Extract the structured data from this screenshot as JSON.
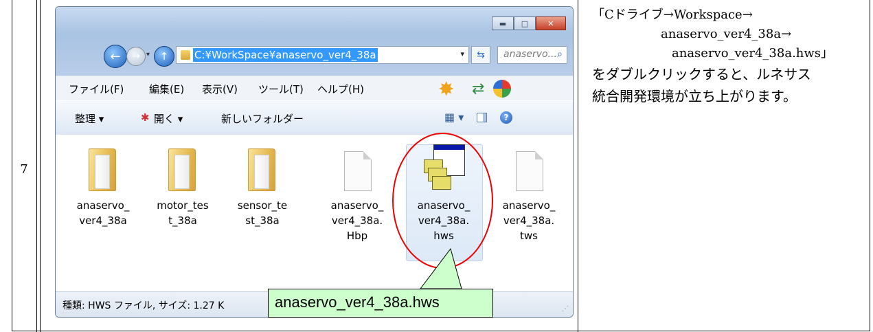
{
  "row": {
    "number": "7"
  },
  "description": {
    "line1": "「Cドライブ→Workspace→",
    "line2": "anaservo_ver4_38a→",
    "line3": "anaservo_ver4_38a.hws」",
    "line4": "をダブルクリックすると、ルネサス",
    "line5": "統合開発環境が立ち上がります。"
  },
  "window": {
    "address_path": "C:¥WorkSpace¥anaservo_ver4_38a",
    "search_placeholder": "anaservo...",
    "menu": [
      "ファイル(F)",
      "編集(E)",
      "表示(V)",
      "ツール(T)",
      "ヘルプ(H)"
    ],
    "toolbar": {
      "organize": "整理 ▾",
      "open": "開く ▾",
      "new_folder": "新しいフォルダー"
    },
    "items": [
      {
        "type": "folder",
        "label1": "anaservo_",
        "label2": "ver4_38a",
        "label3": ""
      },
      {
        "type": "folder",
        "label1": "motor_tes",
        "label2": "t_38a",
        "label3": ""
      },
      {
        "type": "folder",
        "label1": "sensor_te",
        "label2": "st_38a",
        "label3": ""
      },
      {
        "type": "file",
        "label1": "anaservo_",
        "label2": "ver4_38a.",
        "label3": "Hbp"
      },
      {
        "type": "hws",
        "label1": "anaservo_",
        "label2": "ver4_38a.",
        "label3": "hws"
      },
      {
        "type": "file",
        "label1": "anaservo_",
        "label2": "ver4_38a.",
        "label3": "tws"
      }
    ],
    "status": "種類: HWS ファイル, サイズ: 1.27 K"
  },
  "callout": {
    "text": "anaservo_ver4_38a.hws"
  },
  "colors": {
    "highlight": "#3399ff",
    "callout_bg": "#ccffcc",
    "ellipse": "#ee0000"
  }
}
